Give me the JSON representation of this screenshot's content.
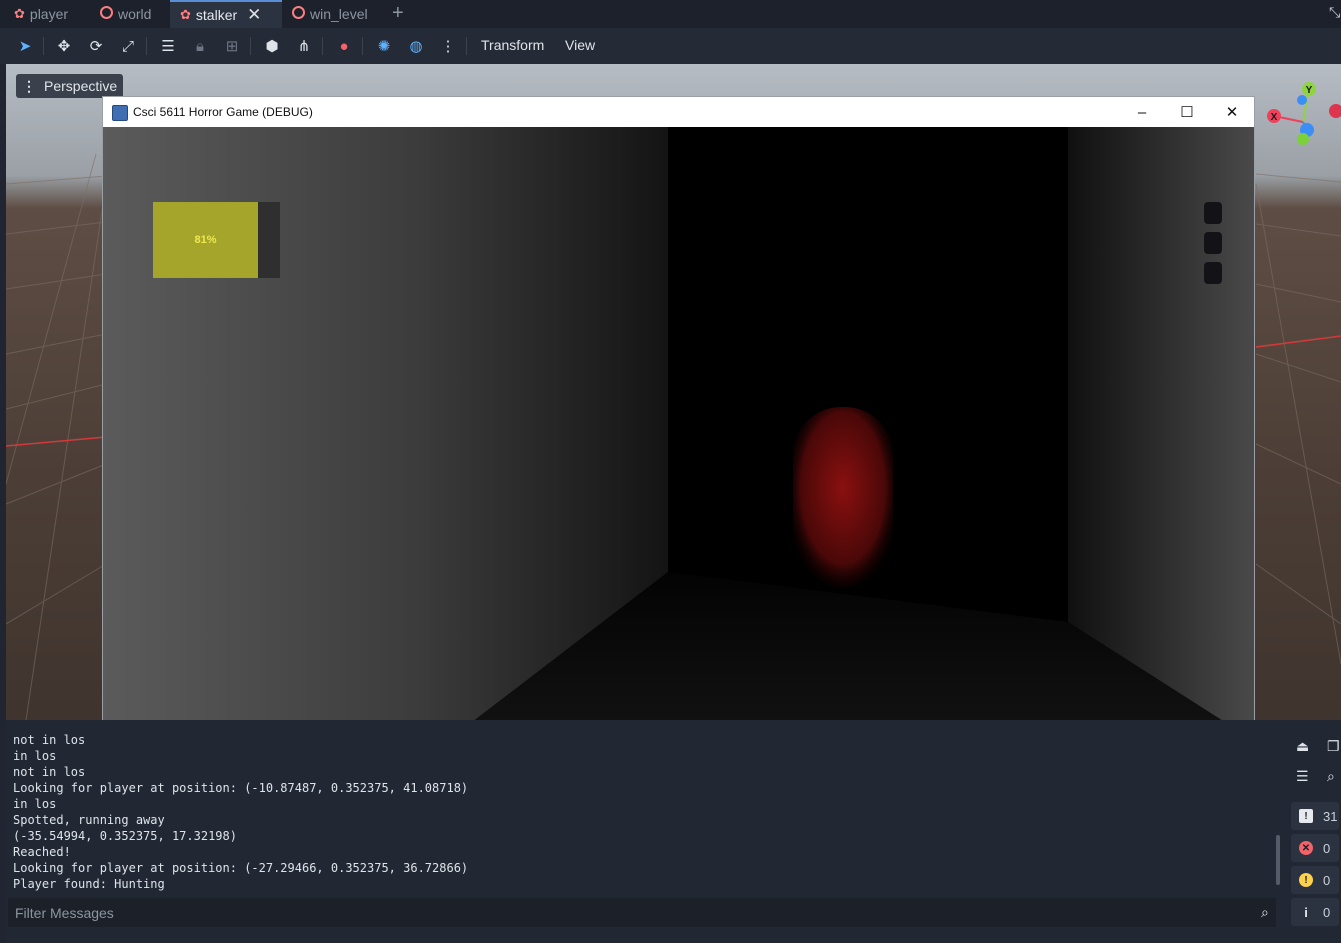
{
  "scene_tabs": [
    {
      "label": "player",
      "icon": "node3d-icon",
      "active": false
    },
    {
      "label": "world",
      "icon": "node3d-ring-icon",
      "active": false
    },
    {
      "label": "stalker",
      "icon": "node3d-icon",
      "active": true
    },
    {
      "label": "win_level",
      "icon": "node3d-ring-icon",
      "active": false
    }
  ],
  "toolbar": {
    "menus": [
      "Transform",
      "View"
    ]
  },
  "viewport": {
    "perspective_label": "Perspective",
    "gizmo": {
      "x": "X",
      "y": "Y"
    }
  },
  "game_window": {
    "title": "Csci 5611 Horror Game (DEBUG)",
    "stamina_label": "81%",
    "stamina_fraction": 0.81
  },
  "output": {
    "lines": [
      "not in los",
      "in los",
      "not in los",
      "Looking for player at position: (-10.87487, 0.352375, 41.08718)",
      "in los",
      "Spotted, running away",
      "(-35.54994, 0.352375, 17.32198)",
      "Reached!",
      "Looking for player at position: (-27.29466, 0.352375, 36.72866)",
      "Player found: Hunting"
    ],
    "filter_placeholder": "Filter Messages",
    "counters": {
      "messages": "31",
      "errors": "0",
      "warnings": "0",
      "info": "0"
    }
  },
  "colors": {
    "accent": "#5a8fd8",
    "stamina": "#a5a52c",
    "stalker_red": "#8a1010",
    "error": "#f2636a",
    "warning": "#ffd24a"
  }
}
